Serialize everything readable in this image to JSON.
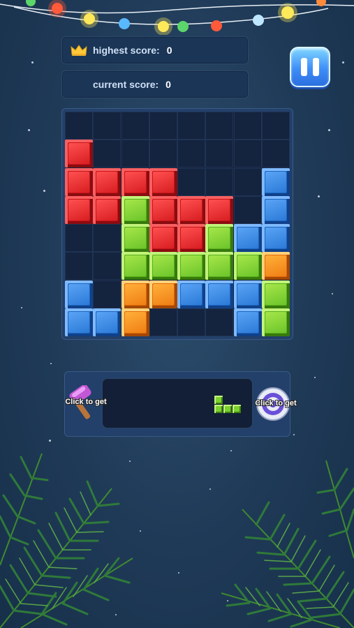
{
  "scores": {
    "highest_label": "highest score:",
    "highest_value": "0",
    "current_label": "current score:",
    "current_value": "0"
  },
  "icons": {
    "crown": "crown-icon",
    "pause": "pause-icon",
    "hammer": "hammer-icon",
    "target": "target-icon"
  },
  "colors": {
    "red": "#d81e22",
    "blue": "#2b7ad8",
    "green": "#6cc52a",
    "orange": "#f07e14",
    "background": "#1f3a57"
  },
  "board": {
    "rows": 8,
    "cols": 8,
    "cells": [
      [
        ".",
        ".",
        ".",
        ".",
        ".",
        ".",
        ".",
        "."
      ],
      [
        "R",
        ".",
        ".",
        ".",
        ".",
        ".",
        ".",
        "."
      ],
      [
        "R",
        "R",
        "R",
        "R",
        ".",
        ".",
        ".",
        "B"
      ],
      [
        "R",
        "R",
        "G",
        "R",
        "R",
        "R",
        ".",
        "B"
      ],
      [
        ".",
        ".",
        "G",
        "R",
        "R",
        "G",
        "B",
        "B"
      ],
      [
        ".",
        ".",
        "G",
        "G",
        "G",
        "G",
        "G",
        "O"
      ],
      [
        "B",
        ".",
        "O",
        "O",
        "B",
        "B",
        "B",
        "G"
      ],
      [
        "B",
        "B",
        "O",
        ".",
        ".",
        ".",
        "B",
        "G"
      ]
    ]
  },
  "tools": {
    "hammer_label": "Click to get",
    "target_label": "Click to get"
  },
  "next_piece": {
    "color": "green",
    "cells": [
      [
        0,
        0
      ],
      [
        1,
        0
      ],
      [
        1,
        1
      ],
      [
        1,
        2
      ]
    ]
  }
}
